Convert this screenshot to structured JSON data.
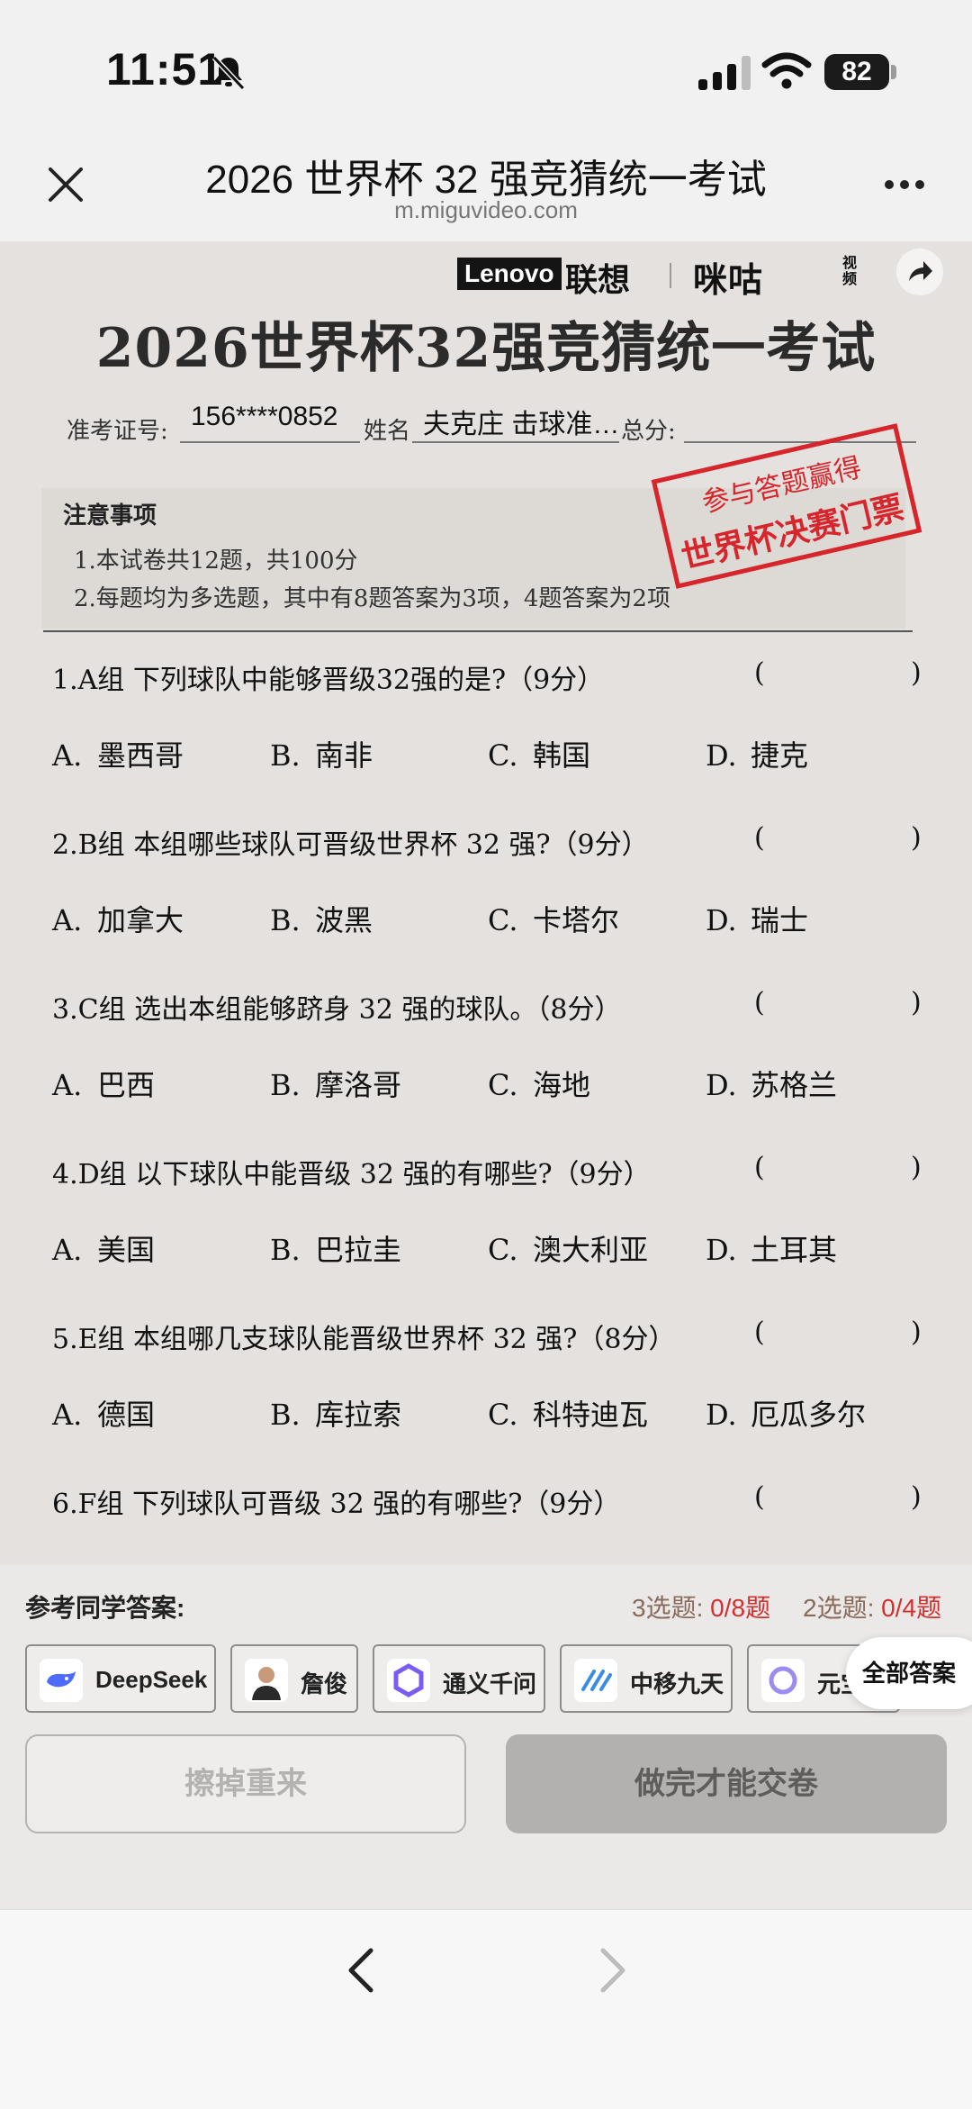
{
  "status_bar": {
    "time": "11:51",
    "battery": "82"
  },
  "nav": {
    "title": "2026 世界杯 32 强竞猜统一考试",
    "url": "m.miguvideo.com"
  },
  "brand": {
    "lenovo_en": "Lenovo",
    "lenovo_cn": "联想",
    "migu": "咪咕",
    "migu_sub": "视频"
  },
  "exam": {
    "title": "2026世界杯32强竞猜统一考试",
    "ticket_label": "准考证号:",
    "ticket_value": "156****0852",
    "name_label": "姓名",
    "name_value": "夫克庄 击球准…",
    "score_label": "总分:",
    "notice_title": "注意事项",
    "notice_1": "1.本试卷共12题，共100分",
    "notice_2": "2.每题均为多选题，其中有8题答案为3项，4题答案为2项",
    "stamp_top": "参与答题赢得",
    "stamp_main": "世界杯决赛门票"
  },
  "questions": [
    {
      "text": "1.A组 下列球队中能够晋级32强的是?（9分）",
      "options": [
        "墨西哥",
        "南非",
        "韩国",
        "捷克"
      ]
    },
    {
      "text": "2.B组 本组哪些球队可晋级世界杯 32 强?（9分）",
      "options": [
        "加拿大",
        "波黑",
        "卡塔尔",
        "瑞士"
      ]
    },
    {
      "text": "3.C组 选出本组能够跻身 32 强的球队。（8分）",
      "options": [
        "巴西",
        "摩洛哥",
        "海地",
        "苏格兰"
      ]
    },
    {
      "text": "4.D组 以下球队中能晋级 32 强的有哪些?（9分）",
      "options": [
        "美国",
        "巴拉圭",
        "澳大利亚",
        "土耳其"
      ]
    },
    {
      "text": "5.E组 本组哪几支球队能晋级世界杯 32 强?（8分）",
      "options": [
        "德国",
        "库拉索",
        "科特迪瓦",
        "厄瓜多尔"
      ]
    },
    {
      "text": "6.F组 下列球队可晋级 32 强的有哪些?（9分）",
      "options": []
    }
  ],
  "option_letters": [
    "A.",
    "B.",
    "C.",
    "D."
  ],
  "panel": {
    "ref_label": "参考同学答案:",
    "score3_prefix": "3选题: ",
    "score3_value": "0/8",
    "score3_suffix": "题",
    "score2_prefix": "2选题: ",
    "score2_value": "0/4",
    "score2_suffix": "题",
    "chips": [
      "DeepSeek",
      "詹俊",
      "通义千问",
      "中移九天",
      "元宝"
    ],
    "all_answers": "全部答案",
    "reset_label": "擦掉重来",
    "submit_label": "做完才能交卷"
  },
  "colors": {
    "accent_red": "#d23030",
    "stamp_red": "#d6262c",
    "paper": "#e4e1de"
  }
}
